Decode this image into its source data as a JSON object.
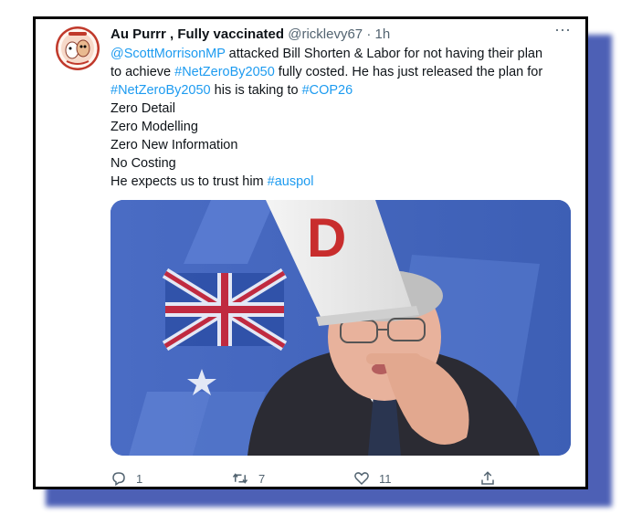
{
  "tweet": {
    "display_name": "Au Purrr , Fully vaccinated",
    "handle": "@ricklevy67",
    "separator": "·",
    "time": "1h",
    "more_label": "···",
    "text": {
      "line1_mention": "@ScottMorrisonMP",
      "line1_rest": " attacked Bill Shorten & Labor for not having their plan",
      "line2_start": "to achieve ",
      "line2_hashtag": "#NetZeroBy2050",
      "line2_rest": " fully costed. He has just released the plan for",
      "line3_hashtag1": "#NetZeroBy2050",
      "line3_mid": " his is taking to ",
      "line3_hashtag2": "#COP26",
      "list": [
        "Zero Detail",
        "Zero Modelling",
        "Zero New Information",
        "No Costing"
      ],
      "last_line_start": "He expects us to trust him ",
      "last_line_hashtag": "#auspol"
    },
    "media_image": {
      "hat_letter": "D"
    },
    "actions": {
      "replies": "1",
      "retweets": "7",
      "likes": "11"
    }
  },
  "colors": {
    "link": "#1d9bf0",
    "text": "#0f1419",
    "muted": "#536471",
    "frame_shadow": "#3a4fae"
  },
  "icons": [
    "avatar-cartoon-icon",
    "more-icon",
    "reply-icon",
    "retweet-icon",
    "like-icon",
    "share-icon"
  ]
}
